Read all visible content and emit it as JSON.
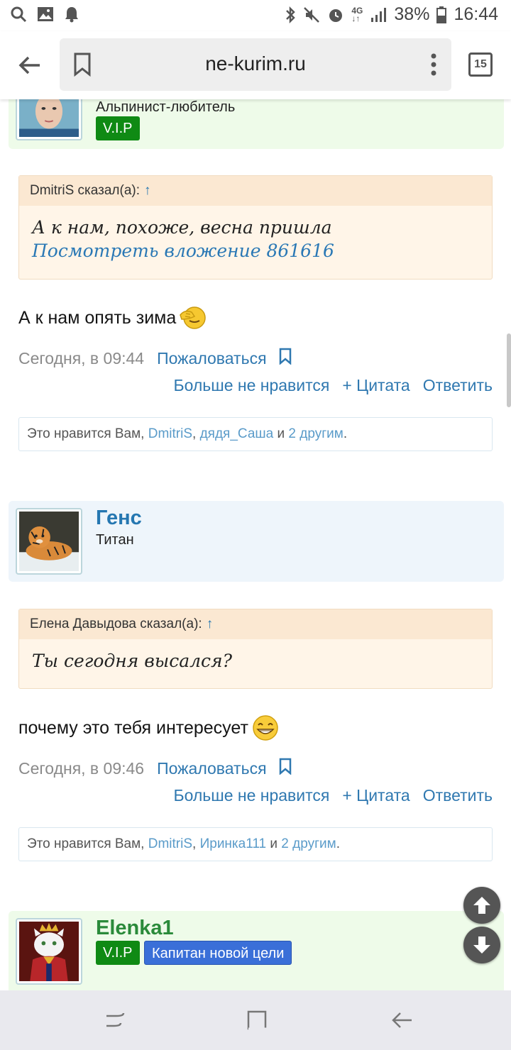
{
  "status_bar": {
    "icons_left": [
      "search-icon",
      "image-icon",
      "bell-icon"
    ],
    "icons_right": [
      "bluetooth-icon",
      "mute-icon",
      "alarm-icon",
      "4g-icon",
      "signal-icon"
    ],
    "battery": "38%",
    "time": "16:44"
  },
  "browser": {
    "url": "ne-kurim.ru",
    "tab_count": "15"
  },
  "posts": [
    {
      "user_title": "Альпинист-любитель",
      "badges": [
        "V.I.P"
      ],
      "quote_author": "DmitriS сказал(а):",
      "quote_arrow": "↑",
      "quote_line1": "А к нам, похоже, весна пришла",
      "quote_line2": "Посмотреть вложение 861616",
      "message": "А к нам опять зима",
      "date": "Сегодня, в 09:44",
      "report": "Пожаловаться",
      "unlike": "Больше не нравится",
      "quote_btn": "+ Цитата",
      "reply": "Ответить",
      "likes_prefix": "Это нравится Вам,",
      "likes_user1": "DmitriS",
      "likes_sep": ",",
      "likes_user2": "дядя_Саша",
      "likes_and": "и",
      "likes_others": "2 другим",
      "likes_end": "."
    },
    {
      "user_name": "Генс",
      "user_title": "Титан",
      "quote_author": "Елена Давыдова сказал(а):",
      "quote_arrow": "↑",
      "quote_line1": "Ты сегодня высался?",
      "message": "почему это тебя интересует",
      "date": "Сегодня, в 09:46",
      "report": "Пожаловаться",
      "unlike": "Больше не нравится",
      "quote_btn": "+ Цитата",
      "reply": "Ответить",
      "likes_prefix": "Это нравится Вам,",
      "likes_user1": "DmitriS",
      "likes_sep": ",",
      "likes_user2": "Иринка111",
      "likes_and": "и",
      "likes_others": "2 другим",
      "likes_end": "."
    },
    {
      "user_name": "Elenka1",
      "badges": [
        "V.I.P",
        "Капитан новой цели"
      ]
    }
  ],
  "colors": {
    "link": "#2f78b0",
    "vip_badge": "#0f8a14",
    "captain_badge": "#3a6fd8",
    "green_userbar": "#eefbe9",
    "blue_userbar": "#eef5fb",
    "quote_bg": "#fff5e8"
  }
}
